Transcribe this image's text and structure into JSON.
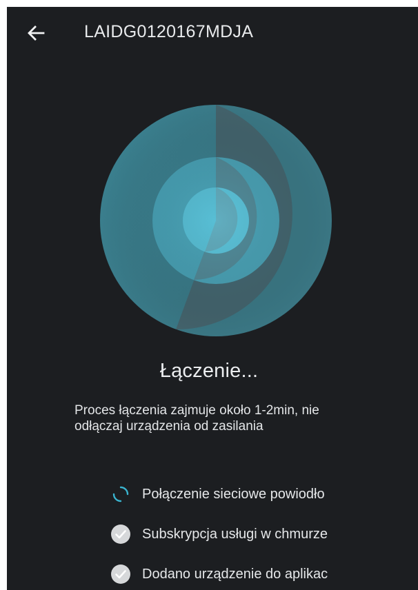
{
  "header": {
    "title": "LAIDG0120167MDJA",
    "back_icon": "arrow-left-icon"
  },
  "status": {
    "heading": "Łączenie...",
    "description_line1": "Proces łączenia zajmuje około 1-2min, nie",
    "description_line2": "odłączaj urządzenia od zasilania"
  },
  "steps": [
    {
      "label": "Połączenie sieciowe powiodło",
      "state": "in-progress",
      "icon": "spinner-icon"
    },
    {
      "label": "Subskrypcja usługi w chmurze",
      "state": "pending",
      "icon": "check-circle-icon"
    },
    {
      "label": "Dodano urządzenie do aplikac",
      "state": "pending",
      "icon": "check-circle-icon"
    }
  ],
  "colors": {
    "background": "#1c1e21",
    "accent": "#3ab5d0",
    "text": "#e6e8ea"
  }
}
